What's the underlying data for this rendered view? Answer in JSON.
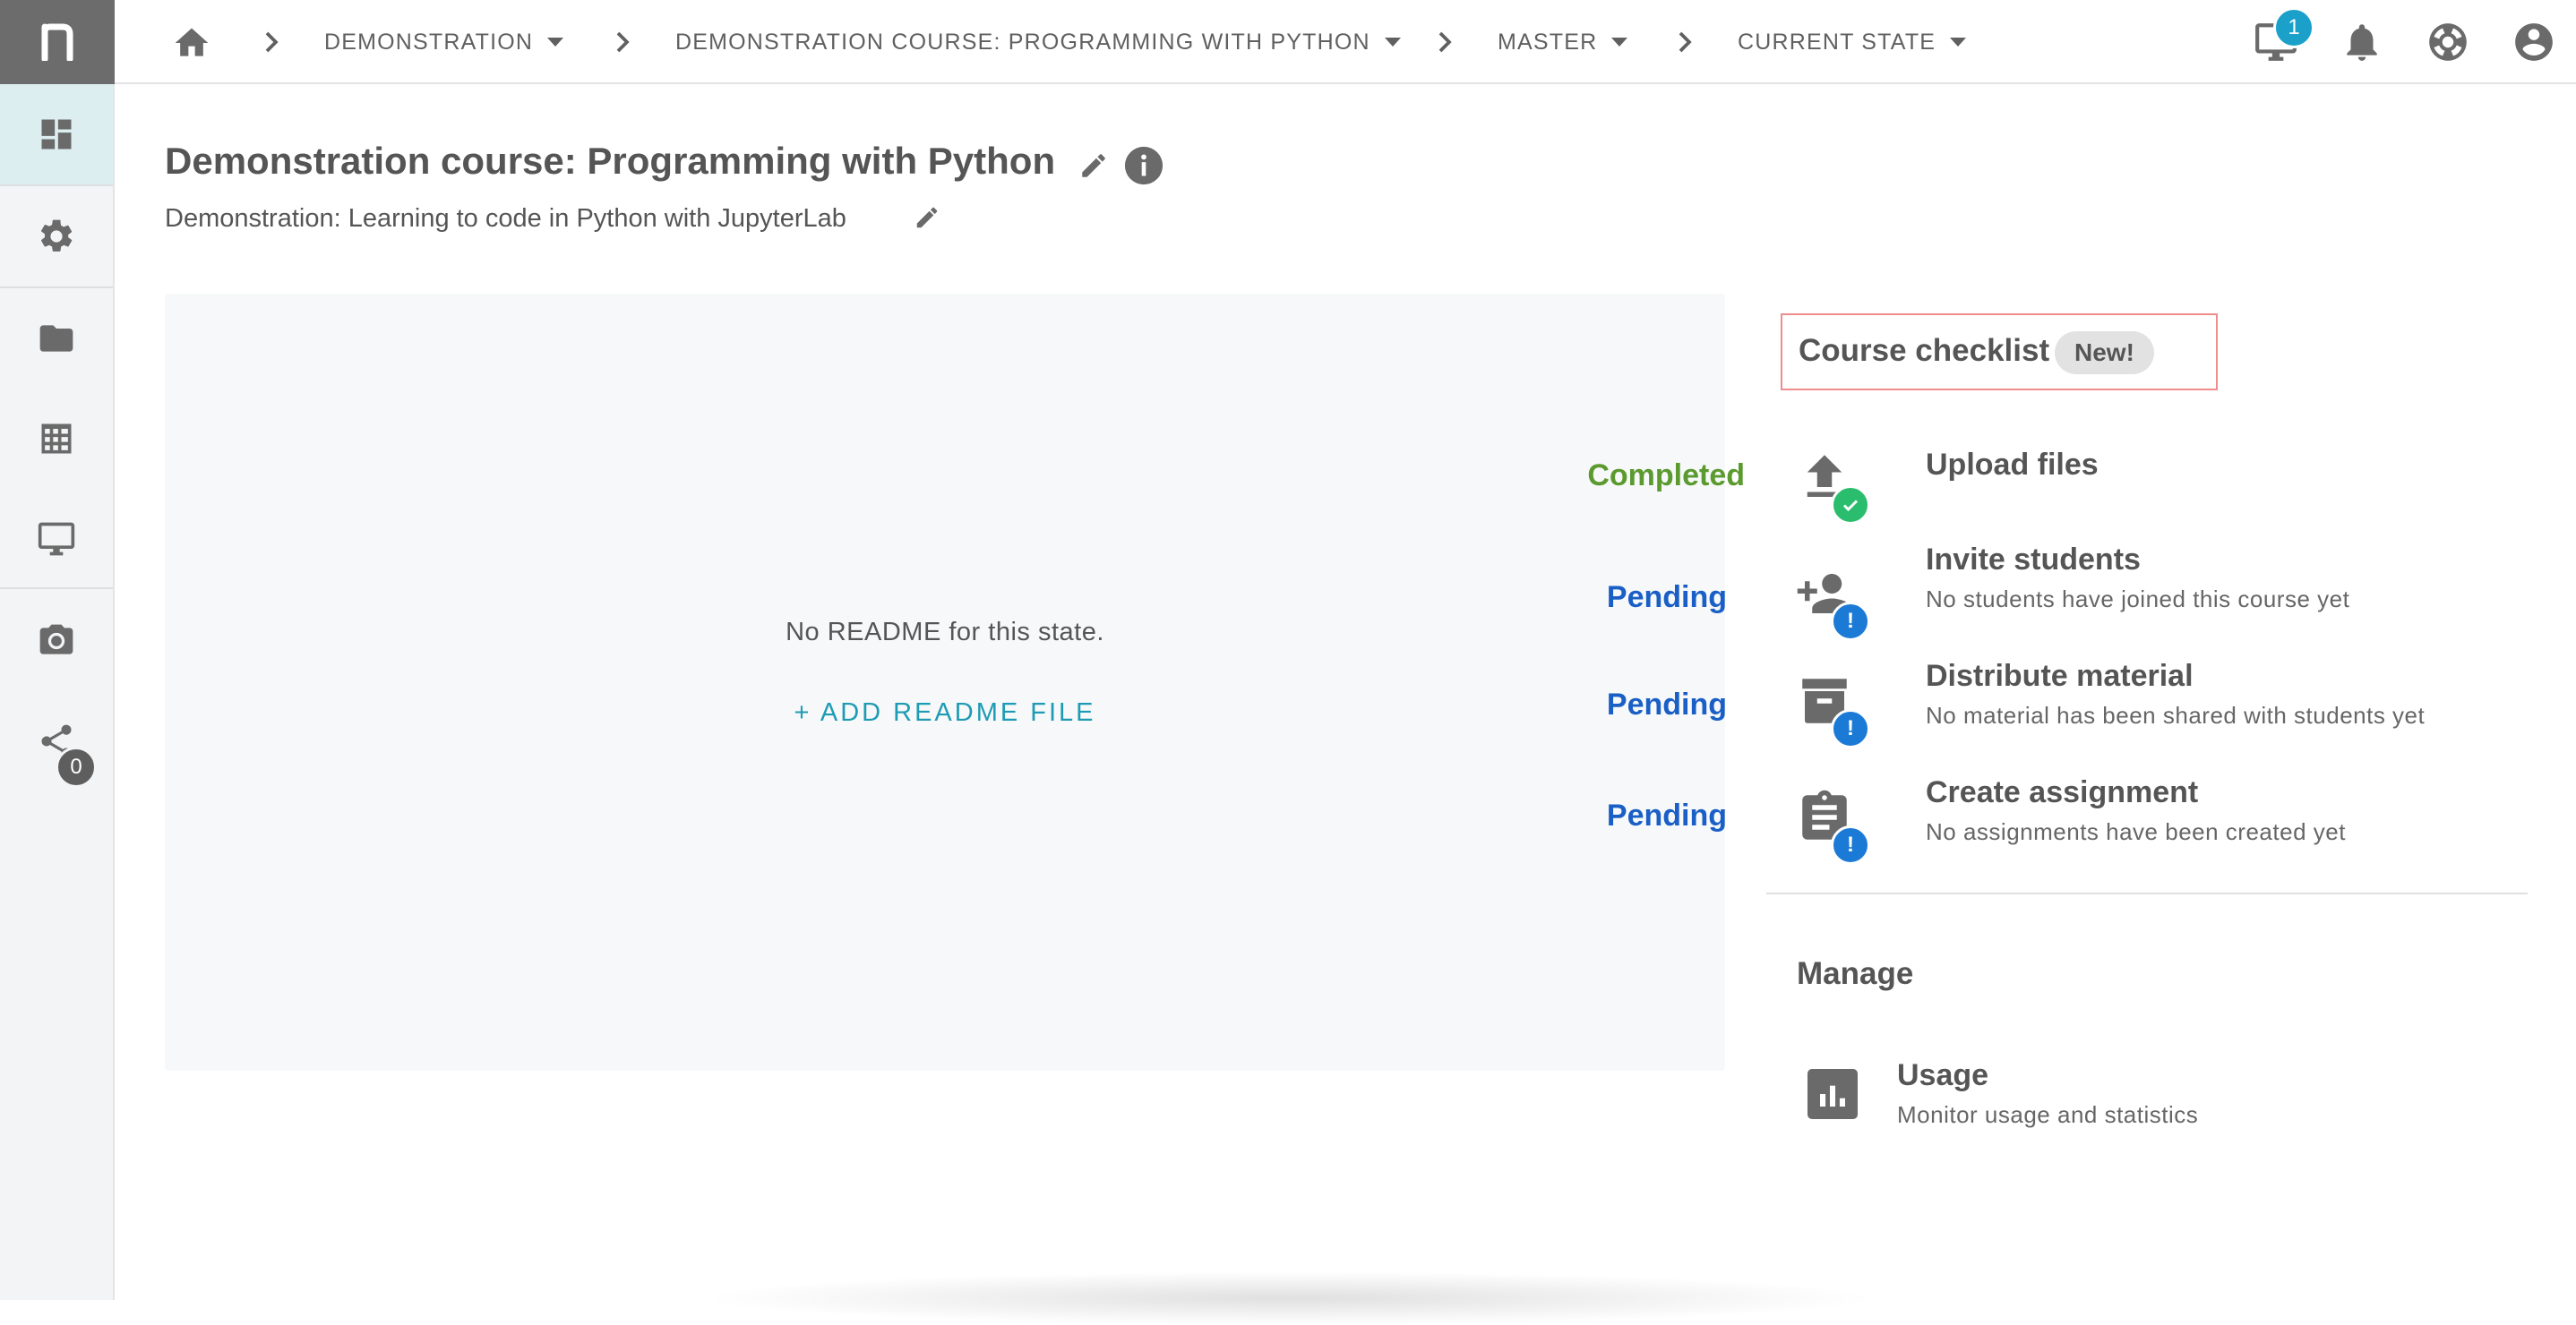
{
  "topbar": {
    "breadcrumbs": [
      {
        "label": "DEMONSTRATION"
      },
      {
        "label": "DEMONSTRATION COURSE: PROGRAMMING WITH PYTHON"
      },
      {
        "label": "MASTER"
      },
      {
        "label": "CURRENT STATE"
      }
    ],
    "notification_count": "1"
  },
  "sidebar": {
    "items": [
      {
        "icon": "dashboard-icon"
      },
      {
        "icon": "gear-icon"
      },
      {
        "icon": "folder-icon"
      },
      {
        "icon": "grid-table-icon"
      },
      {
        "icon": "monitor-icon"
      },
      {
        "icon": "camera-icon"
      },
      {
        "icon": "share-icon"
      }
    ],
    "share_count": "0"
  },
  "header": {
    "title": "Demonstration course: Programming with Python",
    "subtitle": "Demonstration: Learning to code in Python with JupyterLab"
  },
  "readme": {
    "empty_text": "No README for this state.",
    "add_label": "+ ADD README FILE"
  },
  "checklist": {
    "title": "Course checklist",
    "badge": "New!",
    "tasks": [
      {
        "status": "Completed",
        "title": "Upload files",
        "description": "",
        "icon": "upload-icon"
      },
      {
        "status": "Pending",
        "title": "Invite students",
        "description": "No students have joined this course yet",
        "icon": "add-person-icon"
      },
      {
        "status": "Pending",
        "title": "Distribute material",
        "description": "No material has been shared with students yet",
        "icon": "archive-icon"
      },
      {
        "status": "Pending",
        "title": "Create assignment",
        "description": "No assignments have been created yet",
        "icon": "clipboard-icon"
      }
    ]
  },
  "manage": {
    "title": "Manage",
    "usage_title": "Usage",
    "usage_description": "Monitor usage and statistics"
  },
  "colors": {
    "completed": "#5a9a2e",
    "pending": "#1a5fc6",
    "accent": "#1e9bb4",
    "highlight_border": "#f08c8c"
  }
}
